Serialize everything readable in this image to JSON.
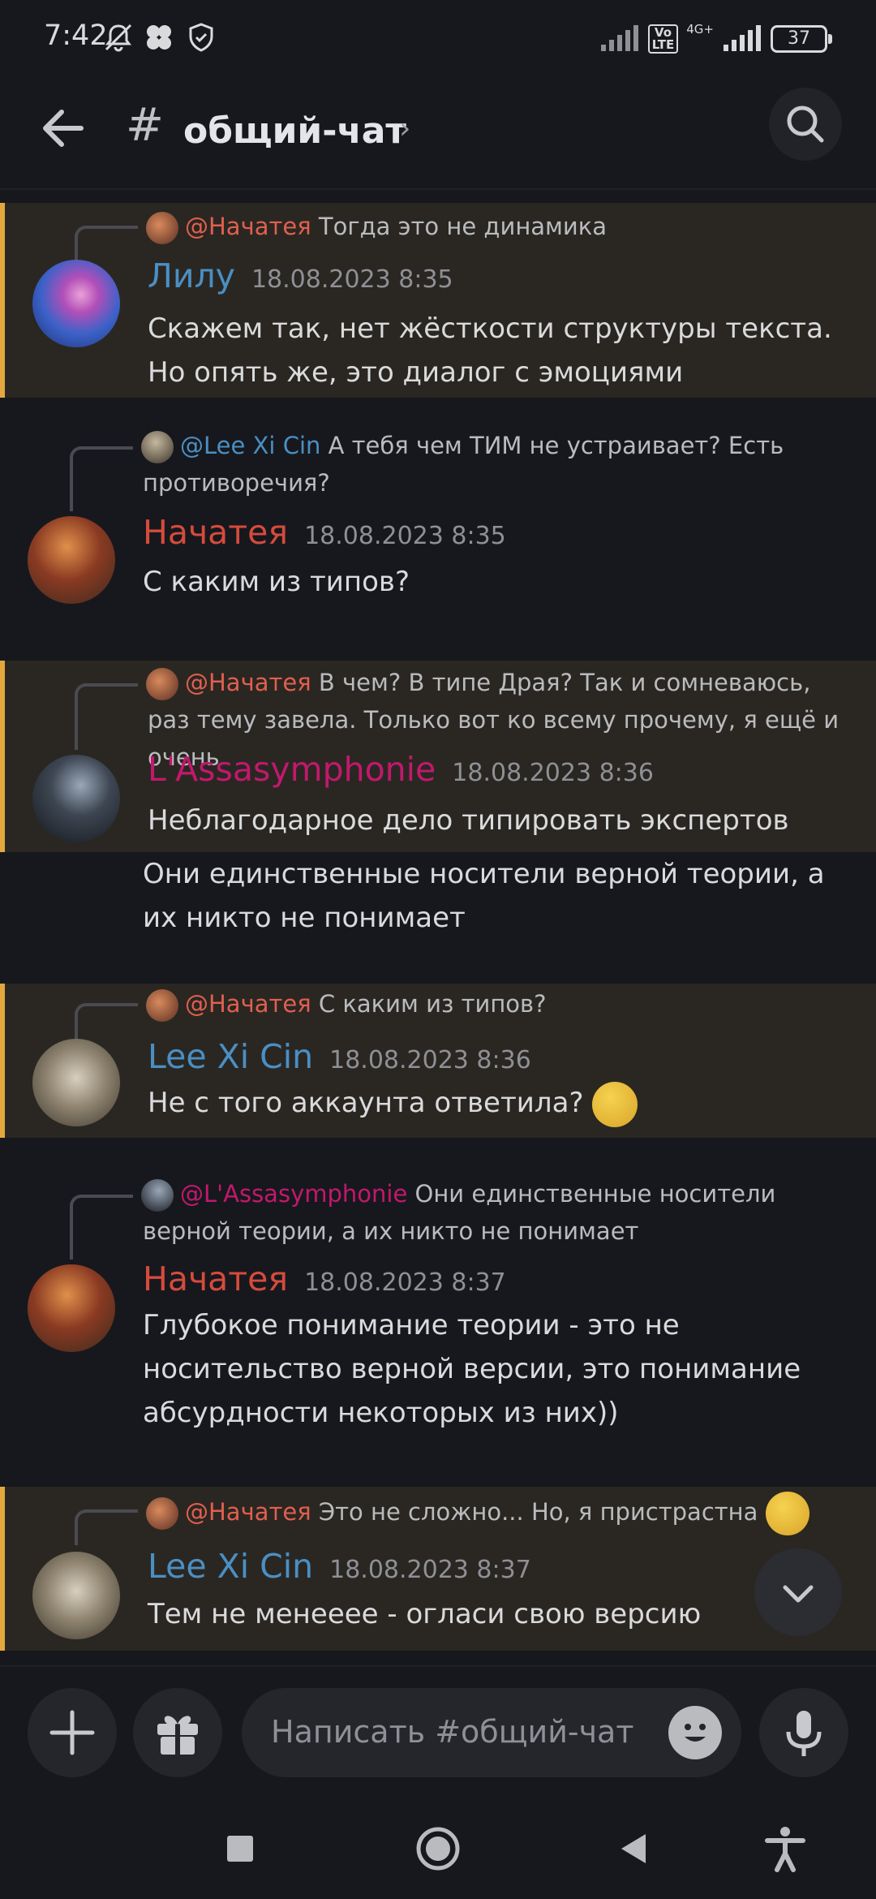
{
  "status_bar": {
    "time": "7:42",
    "volte": "Vo\nLTE",
    "network": "4G+",
    "battery": "37"
  },
  "header": {
    "channel_name": "общий-чат",
    "chevron": "›"
  },
  "messages": [
    {
      "reply_mention": "@Начатея",
      "reply_text": "Тогда это не динамика",
      "author": "Лилу",
      "timestamp": "18.08.2023 8:35",
      "text": "Скажем так, нет жёсткости структуры текста. Но опять же, это диалог с эмоциями"
    },
    {
      "reply_mention": "@Lee Xi Cin",
      "reply_text": "А тебя чем ТИМ не устраивает? Есть противоречия?",
      "author": "Начатея",
      "timestamp": "18.08.2023 8:35",
      "text": "С каким из типов?"
    },
    {
      "reply_mention": "@Начатея",
      "reply_text": "В чем? В типе Драя? Так и сомневаюсь, раз тему завела. Только вот ко всему прочему, я ещё и очень",
      "author": "L'Assasymphonie",
      "timestamp": "18.08.2023 8:36",
      "text": "Неблагодарное дело типировать экспертов",
      "followup": "Они единственные носители верной теории, а их никто не понимает"
    },
    {
      "reply_mention": "@Начатея",
      "reply_text": "С каким из типов?",
      "author": "Lee Xi Cin",
      "timestamp": "18.08.2023 8:36",
      "text": "Не с того аккаунта ответила?"
    },
    {
      "reply_mention": "@L'Assasymphonie",
      "reply_text": "Они единственные носители верной теории, а их никто не понимает",
      "author": "Начатея",
      "timestamp": "18.08.2023 8:37",
      "text": "Глубокое понимание теории - это не носительство верной версии, это понимание абсурдности некоторых из них))"
    },
    {
      "reply_mention": "@Начатея",
      "reply_text": "Это не сложно... Но, я пристрастна",
      "author": "Lee Xi Cin",
      "timestamp": "18.08.2023 8:37",
      "text": "Тем не менееее - огласи свою версию"
    }
  ],
  "composer": {
    "placeholder": "Написать #общий-чат"
  },
  "colors": {
    "background": "#17181d",
    "highlight_bg": "#2a2722",
    "highlight_bar": "#e3a83d",
    "name_red": "#d64b3c",
    "name_blue": "#4a8fc4",
    "name_pink": "#c2186d"
  },
  "icons": [
    "back-arrow-icon",
    "hash-icon",
    "search-icon",
    "plus-icon",
    "gift-icon",
    "emoji-icon",
    "microphone-icon",
    "chevron-down-icon",
    "recents-icon",
    "home-icon",
    "back-triangle-icon",
    "accessibility-icon"
  ]
}
